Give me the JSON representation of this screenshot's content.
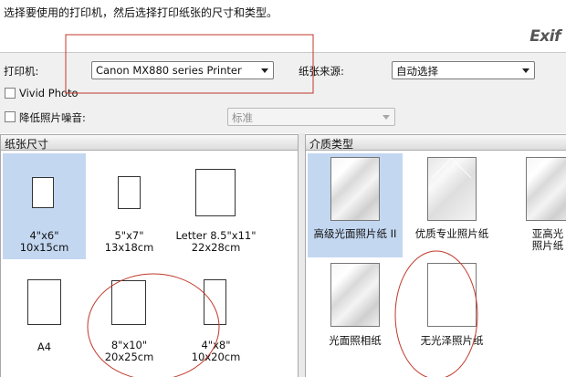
{
  "header": {
    "instruction": "选择要使用的打印机，然后选择打印纸张的尺寸和类型。",
    "logo": "Exif"
  },
  "settings": {
    "printer_label": "打印机:",
    "printer_value": "Canon MX880 series Printer",
    "source_label": "纸张来源:",
    "source_value": "自动选择",
    "vivid_label": "Vivid Photo",
    "noise_label": "降低照片噪音:",
    "noise_value": "标准"
  },
  "paper_panel": {
    "title": "纸张尺寸",
    "items": [
      {
        "line1": "4\"x6\"",
        "line2": "10x15cm",
        "selected": true
      },
      {
        "line1": "5\"x7\"",
        "line2": "13x18cm",
        "selected": false
      },
      {
        "line1": "Letter 8.5\"x11\"",
        "line2": "22x28cm",
        "selected": false
      },
      {
        "line1": "A4",
        "line2": "",
        "selected": false
      },
      {
        "line1": "8\"x10\"",
        "line2": "20x25cm",
        "selected": false
      },
      {
        "line1": "4\"x8\"",
        "line2": "10x20cm",
        "selected": false
      }
    ]
  },
  "media_panel": {
    "title": "介质类型",
    "items": [
      {
        "line1": "高级光面照片纸 II",
        "line2": "",
        "selected": true
      },
      {
        "line1": "优质专业照片纸",
        "line2": "",
        "selected": false
      },
      {
        "line1": "亚高光",
        "line2": "照片纸",
        "selected": false
      },
      {
        "line1": "光面照相纸",
        "line2": "",
        "selected": false
      },
      {
        "line1": "无光泽照片纸",
        "line2": "",
        "selected": false
      }
    ]
  },
  "colors": {
    "selection": "#c3d7f1",
    "annotation": "#c0392b"
  }
}
